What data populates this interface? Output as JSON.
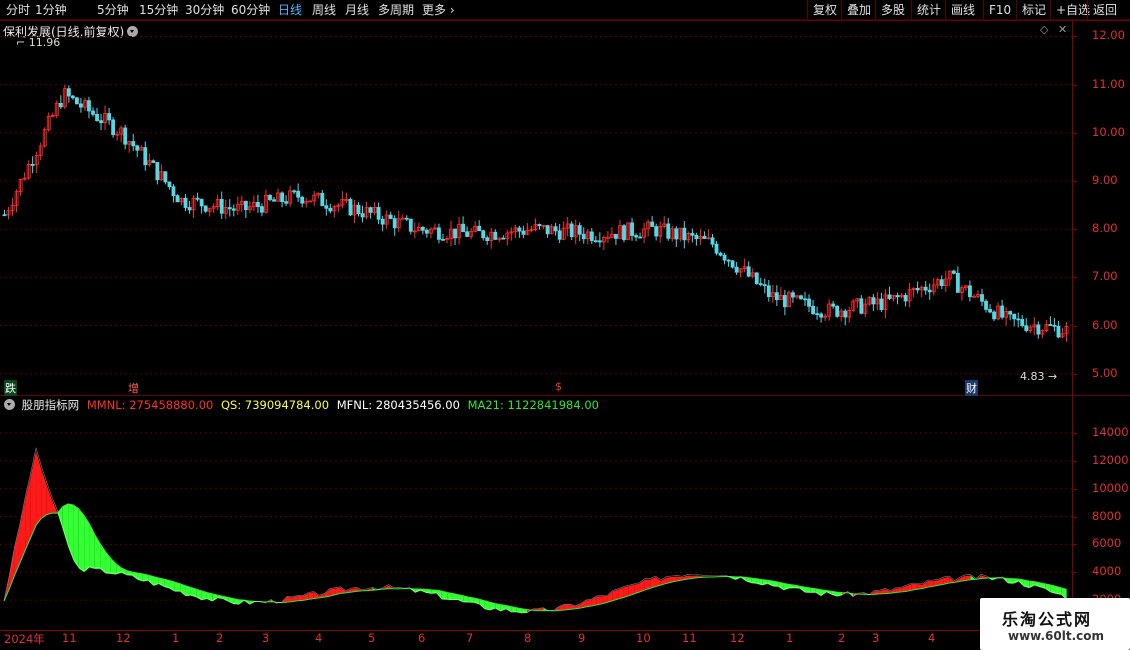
{
  "toolbar": {
    "periods": [
      "分时",
      "1分钟",
      "5分钟",
      "15分钟",
      "30分钟",
      "60分钟",
      "日线",
      "周线",
      "月线",
      "多周期",
      "更多"
    ],
    "active_period": "日线",
    "tools": [
      "复权",
      "叠加",
      "多股",
      "统计",
      "画线",
      "F10",
      "标记",
      "+自选",
      "返回"
    ]
  },
  "kline": {
    "title": "保利发展(日线,前复权)",
    "high_label": "11.96",
    "low_label": "4.83",
    "markers": [
      "跌",
      "增",
      "$",
      "财"
    ]
  },
  "indicator": {
    "name": "股朋指标网",
    "mmnl": "MMNL: 275458880.00",
    "qs": "QS: 739094784.00",
    "mfnl": "MFNL: 280435456.00",
    "ma21": "MA21: 1122841984.00"
  },
  "colors": {
    "up": "#ff2d2d",
    "down": "#54d8e6",
    "mmnl": "#ff3030",
    "qs": "#ffff40",
    "mfnl": "#ffffff",
    "ma21": "#32e632",
    "area_red": "#ff1a1a",
    "area_green": "#33ff33"
  },
  "chart_data": [
    {
      "type": "line",
      "title": "保利发展(日线,前复权)",
      "ylim": [
        4.6,
        12.3
      ],
      "yticks": [
        "12.00",
        "11.00",
        "10.00",
        "9.00",
        "8.00",
        "7.00",
        "6.00",
        "5.00"
      ],
      "series": [
        {
          "name": "保利发展",
          "x": [
            "2023-10",
            "2023-11",
            "2023-12",
            "2024-01",
            "2024-02",
            "2024-03",
            "2024-04",
            "2024-05",
            "2024-06",
            "2024-07",
            "2024-08",
            "2024-09",
            "2024-10",
            "2024-11",
            "2024-12",
            "2025-01",
            "2025-02",
            "2025-03",
            "2025-04"
          ],
          "values": [
            8.3,
            10.8,
            10.0,
            8.6,
            8.4,
            8.7,
            8.4,
            8.0,
            7.9,
            8.0,
            7.9,
            8.0,
            7.7,
            6.6,
            6.3,
            6.5,
            7.0,
            6.1,
            5.9
          ]
        }
      ],
      "max": 11.96,
      "min": 4.83
    },
    {
      "type": "area",
      "title": "股朋指标网",
      "ylim": [
        0,
        15500
      ],
      "yticks": [
        "14000",
        "12000",
        "10000",
        "8000",
        "6000",
        "4000",
        "2000"
      ],
      "x_labels": [
        "2024年",
        "11",
        "12",
        "1",
        "2",
        "3",
        "4",
        "5",
        "6",
        "7",
        "8",
        "9",
        "10",
        "11",
        "12",
        "1",
        "2",
        "3",
        "4"
      ],
      "series": [
        {
          "name": "MMNL",
          "values": [
            2754.6
          ]
        },
        {
          "name": "QS",
          "values": [
            7390.9
          ]
        },
        {
          "name": "MFNL",
          "values": [
            2804.4
          ]
        },
        {
          "name": "MA21",
          "values": [
            11228.4
          ]
        }
      ]
    }
  ]
}
